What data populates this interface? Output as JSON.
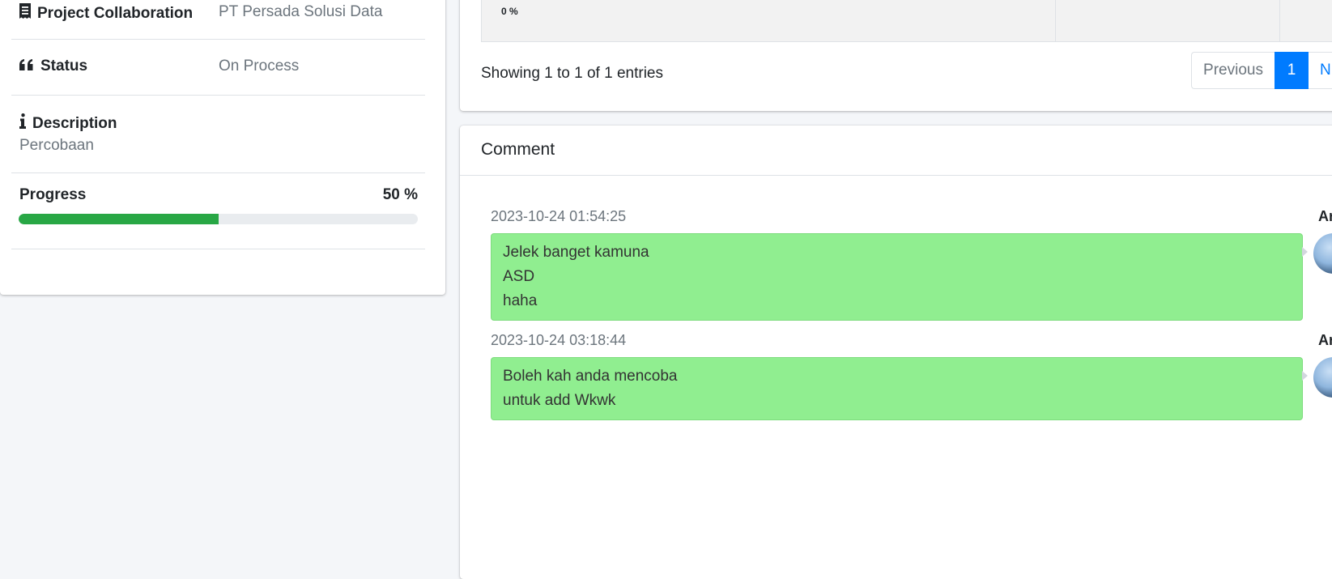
{
  "info": {
    "collaboration_label": "Project Collaboration",
    "collaboration_value": "PT Persada Solusi Data",
    "status_label": "Status",
    "status_value": "On Process",
    "description_label": "Description",
    "description_value": "Percobaan",
    "progress_label": "Progress",
    "progress_text": "50 %",
    "progress_value": 50,
    "progress_color": "#28a745"
  },
  "table": {
    "row_progress": "0 %",
    "showing": "Showing 1 to 1 of 1 entries",
    "pagination": {
      "previous": "Previous",
      "current": "1",
      "next": "N"
    }
  },
  "comments": {
    "title": "Comment",
    "items": [
      {
        "time": "2023-10-24 01:54:25",
        "author": "Ar",
        "lines": [
          "Jelek banget kamuna",
          "ASD",
          "haha"
        ]
      },
      {
        "time": "2023-10-24 03:18:44",
        "author": "Ar",
        "lines": [
          "Boleh kah anda mencoba",
          "untuk add Wkwk"
        ]
      }
    ]
  },
  "colors": {
    "bubble": "#90ee90",
    "active_page": "#007bff"
  }
}
